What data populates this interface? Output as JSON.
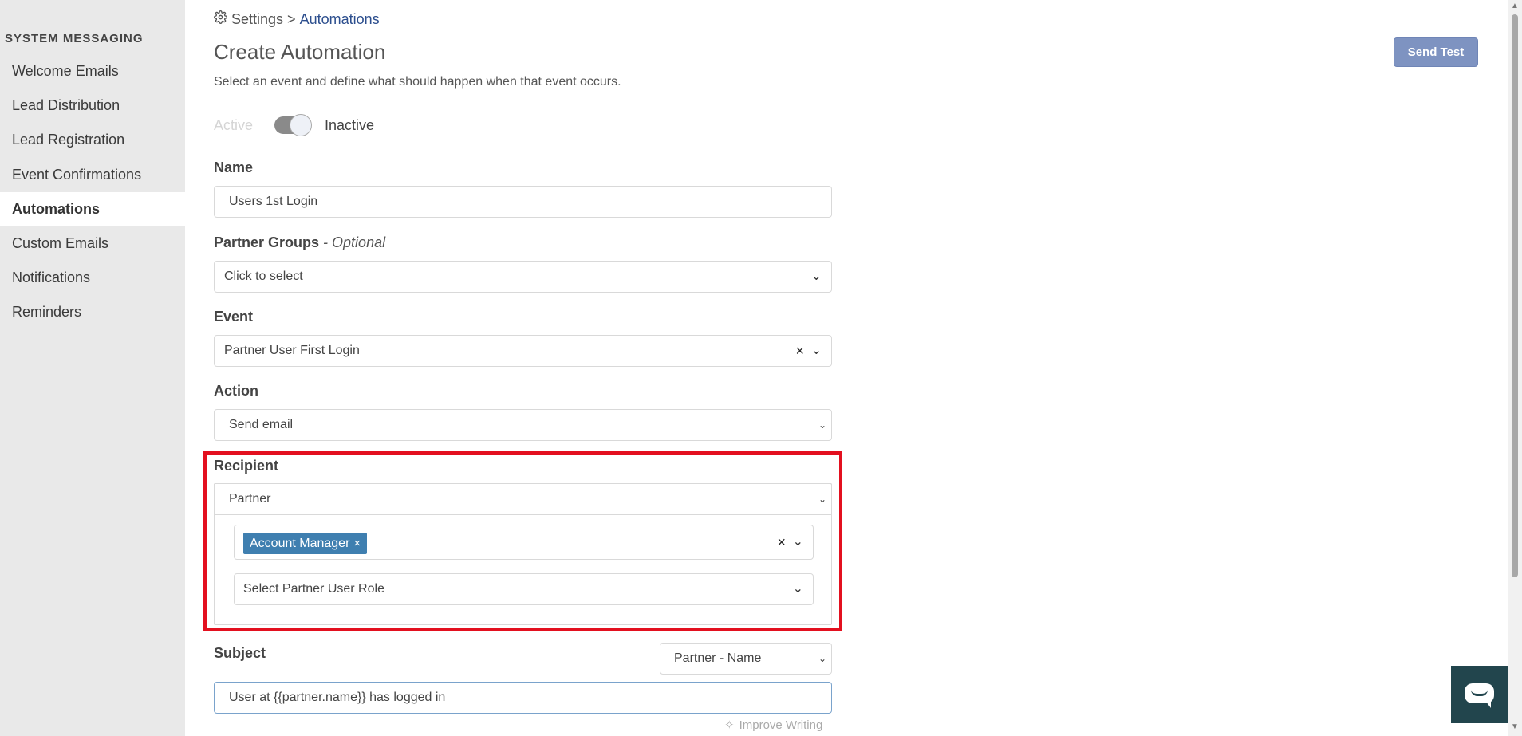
{
  "sidebar": {
    "heading": "SYSTEM MESSAGING",
    "items": [
      {
        "label": "Welcome Emails"
      },
      {
        "label": "Lead Distribution"
      },
      {
        "label": "Lead Registration"
      },
      {
        "label": "Event Confirmations"
      },
      {
        "label": "Automations",
        "active": true
      },
      {
        "label": "Custom Emails"
      },
      {
        "label": "Notifications"
      },
      {
        "label": "Reminders"
      }
    ]
  },
  "breadcrumb": {
    "icon": "gear-icon",
    "root": "Settings",
    "separator": ">",
    "current": "Automations"
  },
  "header": {
    "title": "Create Automation",
    "subtitle": "Select an event and define what should happen when that event occurs.",
    "send_test_label": "Send Test"
  },
  "status_toggle": {
    "active_label": "Active",
    "inactive_label": "Inactive",
    "state": "Inactive"
  },
  "form": {
    "name": {
      "label": "Name",
      "value": "Users 1st Login"
    },
    "partner_groups": {
      "label": "Partner Groups",
      "optional": "- Optional",
      "placeholder": "Click to select"
    },
    "event": {
      "label": "Event",
      "value": "Partner User First Login"
    },
    "action": {
      "label": "Action",
      "value": "Send email"
    },
    "recipient": {
      "label": "Recipient",
      "value": "Partner",
      "selected_tags": [
        "Account Manager"
      ],
      "role_placeholder": "Select Partner User Role"
    },
    "subject": {
      "label": "Subject",
      "merge_field": "Partner - Name",
      "value": "User at {{partner.name}} has logged in",
      "improve_label": "Improve Writing"
    }
  },
  "colors": {
    "accent": "#2d4f8e",
    "button": "#7e93c1",
    "highlight": "#e3101f",
    "tag": "#3f7fb0",
    "chat": "#22454d"
  }
}
